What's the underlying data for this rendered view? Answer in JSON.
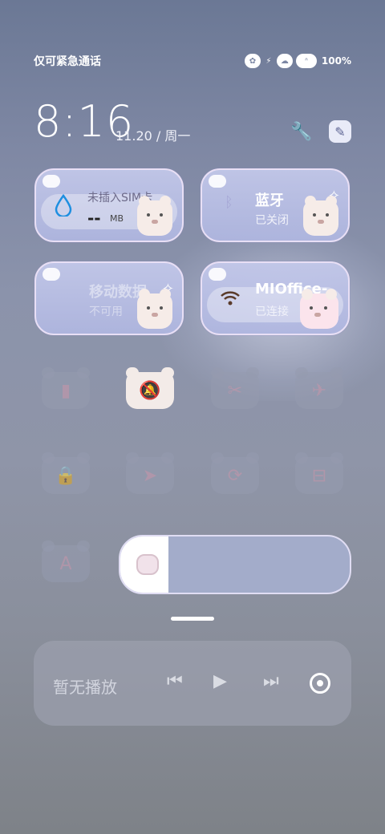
{
  "status_bar": {
    "carrier": "仅可紧急通话",
    "battery": "100%"
  },
  "header": {
    "time": "8:16",
    "date": "11.20 / 周一",
    "settings_icon": "wrench-icon",
    "edit_icon": "edit-icon"
  },
  "tiles": {
    "data_usage": {
      "label": "未插入SIM卡",
      "value": "--",
      "unit": "MB"
    },
    "bluetooth": {
      "title": "蓝牙",
      "status": "已关闭"
    },
    "mobile_data": {
      "title": "移动数据",
      "status": "不可用"
    },
    "wifi": {
      "title": "MIOffice-",
      "status": "已连接"
    }
  },
  "toggles": [
    {
      "name": "flashlight",
      "icon": "flashlight-icon",
      "active": false
    },
    {
      "name": "mute",
      "icon": "bell-off-icon",
      "active": true
    },
    {
      "name": "screenshot",
      "icon": "screenshot-icon",
      "active": false
    },
    {
      "name": "airplane",
      "icon": "airplane-icon",
      "active": false
    },
    {
      "name": "lock",
      "icon": "lock-icon",
      "active": false
    },
    {
      "name": "location",
      "icon": "location-icon",
      "active": false
    },
    {
      "name": "rotation-lock",
      "icon": "rotation-lock-icon",
      "active": false
    },
    {
      "name": "scan",
      "icon": "scan-icon",
      "active": false
    },
    {
      "name": "font",
      "icon": "font-icon",
      "active": false
    }
  ],
  "brightness": {
    "level_fraction": 0.21
  },
  "media": {
    "label": "暂无播放"
  }
}
